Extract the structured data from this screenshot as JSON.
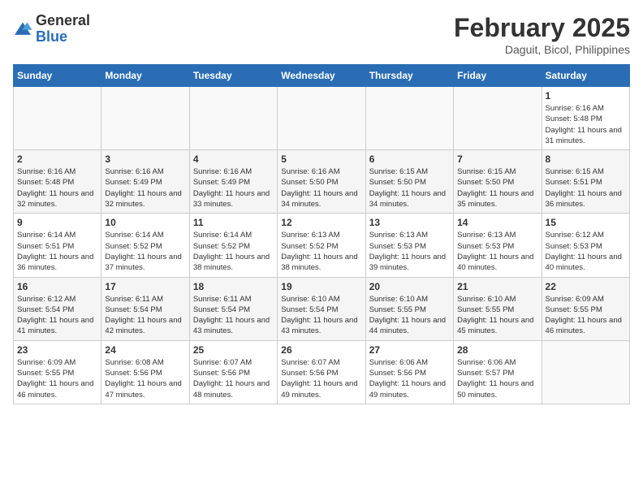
{
  "header": {
    "logo_general": "General",
    "logo_blue": "Blue",
    "month_year": "February 2025",
    "location": "Daguit, Bicol, Philippines"
  },
  "days_of_week": [
    "Sunday",
    "Monday",
    "Tuesday",
    "Wednesday",
    "Thursday",
    "Friday",
    "Saturday"
  ],
  "weeks": [
    {
      "shade": false,
      "days": [
        {
          "num": "",
          "info": ""
        },
        {
          "num": "",
          "info": ""
        },
        {
          "num": "",
          "info": ""
        },
        {
          "num": "",
          "info": ""
        },
        {
          "num": "",
          "info": ""
        },
        {
          "num": "",
          "info": ""
        },
        {
          "num": "1",
          "info": "Sunrise: 6:16 AM\nSunset: 5:48 PM\nDaylight: 11 hours and 31 minutes."
        }
      ]
    },
    {
      "shade": true,
      "days": [
        {
          "num": "2",
          "info": "Sunrise: 6:16 AM\nSunset: 5:48 PM\nDaylight: 11 hours and 32 minutes."
        },
        {
          "num": "3",
          "info": "Sunrise: 6:16 AM\nSunset: 5:49 PM\nDaylight: 11 hours and 32 minutes."
        },
        {
          "num": "4",
          "info": "Sunrise: 6:16 AM\nSunset: 5:49 PM\nDaylight: 11 hours and 33 minutes."
        },
        {
          "num": "5",
          "info": "Sunrise: 6:16 AM\nSunset: 5:50 PM\nDaylight: 11 hours and 34 minutes."
        },
        {
          "num": "6",
          "info": "Sunrise: 6:15 AM\nSunset: 5:50 PM\nDaylight: 11 hours and 34 minutes."
        },
        {
          "num": "7",
          "info": "Sunrise: 6:15 AM\nSunset: 5:50 PM\nDaylight: 11 hours and 35 minutes."
        },
        {
          "num": "8",
          "info": "Sunrise: 6:15 AM\nSunset: 5:51 PM\nDaylight: 11 hours and 36 minutes."
        }
      ]
    },
    {
      "shade": false,
      "days": [
        {
          "num": "9",
          "info": "Sunrise: 6:14 AM\nSunset: 5:51 PM\nDaylight: 11 hours and 36 minutes."
        },
        {
          "num": "10",
          "info": "Sunrise: 6:14 AM\nSunset: 5:52 PM\nDaylight: 11 hours and 37 minutes."
        },
        {
          "num": "11",
          "info": "Sunrise: 6:14 AM\nSunset: 5:52 PM\nDaylight: 11 hours and 38 minutes."
        },
        {
          "num": "12",
          "info": "Sunrise: 6:13 AM\nSunset: 5:52 PM\nDaylight: 11 hours and 38 minutes."
        },
        {
          "num": "13",
          "info": "Sunrise: 6:13 AM\nSunset: 5:53 PM\nDaylight: 11 hours and 39 minutes."
        },
        {
          "num": "14",
          "info": "Sunrise: 6:13 AM\nSunset: 5:53 PM\nDaylight: 11 hours and 40 minutes."
        },
        {
          "num": "15",
          "info": "Sunrise: 6:12 AM\nSunset: 5:53 PM\nDaylight: 11 hours and 40 minutes."
        }
      ]
    },
    {
      "shade": true,
      "days": [
        {
          "num": "16",
          "info": "Sunrise: 6:12 AM\nSunset: 5:54 PM\nDaylight: 11 hours and 41 minutes."
        },
        {
          "num": "17",
          "info": "Sunrise: 6:11 AM\nSunset: 5:54 PM\nDaylight: 11 hours and 42 minutes."
        },
        {
          "num": "18",
          "info": "Sunrise: 6:11 AM\nSunset: 5:54 PM\nDaylight: 11 hours and 43 minutes."
        },
        {
          "num": "19",
          "info": "Sunrise: 6:10 AM\nSunset: 5:54 PM\nDaylight: 11 hours and 43 minutes."
        },
        {
          "num": "20",
          "info": "Sunrise: 6:10 AM\nSunset: 5:55 PM\nDaylight: 11 hours and 44 minutes."
        },
        {
          "num": "21",
          "info": "Sunrise: 6:10 AM\nSunset: 5:55 PM\nDaylight: 11 hours and 45 minutes."
        },
        {
          "num": "22",
          "info": "Sunrise: 6:09 AM\nSunset: 5:55 PM\nDaylight: 11 hours and 46 minutes."
        }
      ]
    },
    {
      "shade": false,
      "days": [
        {
          "num": "23",
          "info": "Sunrise: 6:09 AM\nSunset: 5:55 PM\nDaylight: 11 hours and 46 minutes."
        },
        {
          "num": "24",
          "info": "Sunrise: 6:08 AM\nSunset: 5:56 PM\nDaylight: 11 hours and 47 minutes."
        },
        {
          "num": "25",
          "info": "Sunrise: 6:07 AM\nSunset: 5:56 PM\nDaylight: 11 hours and 48 minutes."
        },
        {
          "num": "26",
          "info": "Sunrise: 6:07 AM\nSunset: 5:56 PM\nDaylight: 11 hours and 49 minutes."
        },
        {
          "num": "27",
          "info": "Sunrise: 6:06 AM\nSunset: 5:56 PM\nDaylight: 11 hours and 49 minutes."
        },
        {
          "num": "28",
          "info": "Sunrise: 6:06 AM\nSunset: 5:57 PM\nDaylight: 11 hours and 50 minutes."
        },
        {
          "num": "",
          "info": ""
        }
      ]
    }
  ]
}
